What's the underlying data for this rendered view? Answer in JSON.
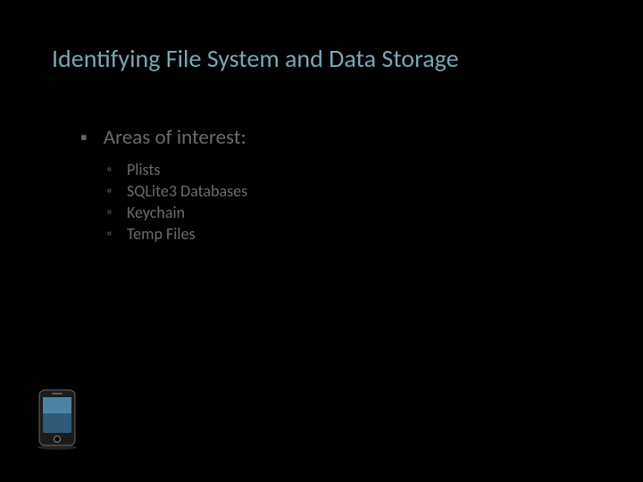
{
  "slide": {
    "title": "Identifying File System and Data Storage",
    "heading": "Areas of interest:",
    "items": [
      "Plists",
      "SQLite3 Databases",
      "Keychain",
      "Temp Files"
    ]
  }
}
